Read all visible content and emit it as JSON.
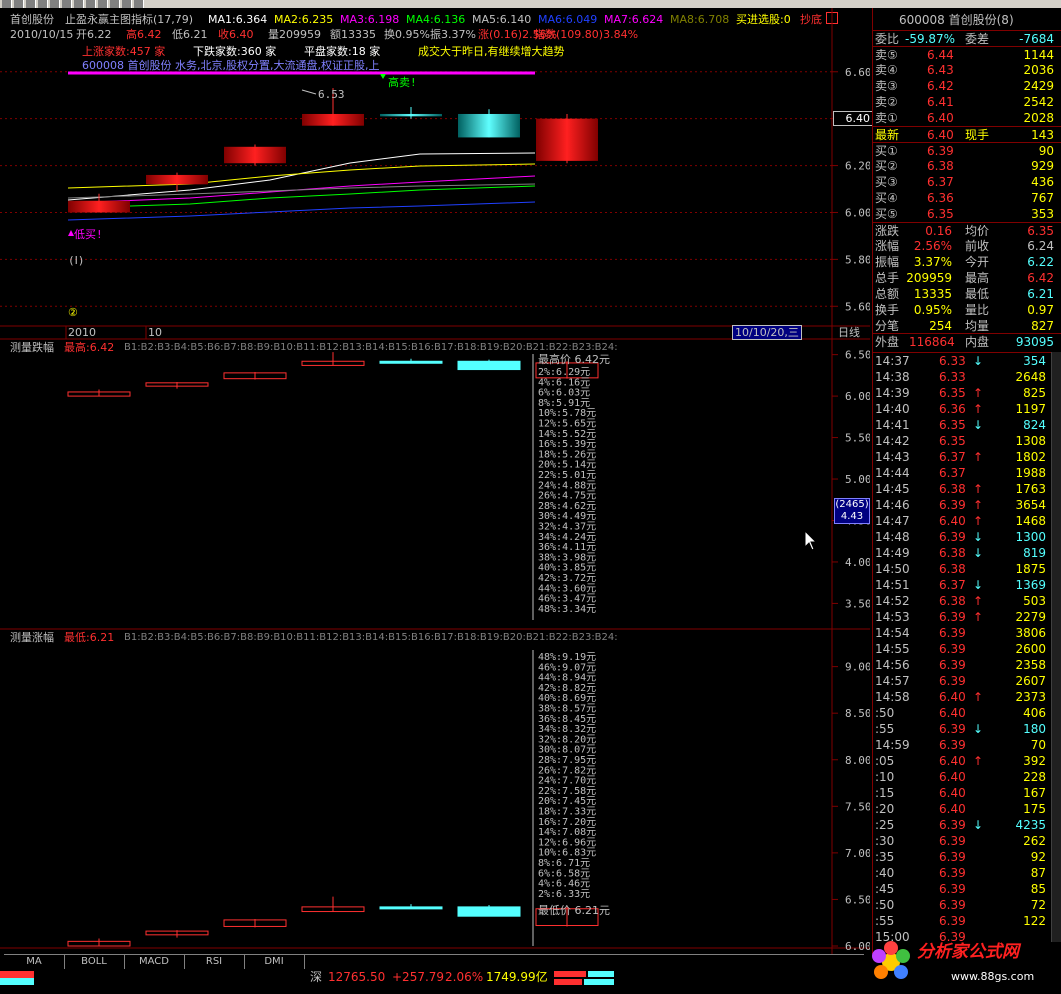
{
  "colors": {
    "up": "#ff3030",
    "down": "#54ffff",
    "flat": "#c0c0c0",
    "grid": "#800000",
    "yellow": "#ffff00",
    "magenta": "#ff00ff",
    "white": "#ffffff",
    "green": "#00ff00",
    "blue": "#2040ff",
    "purple": "#b000b0"
  },
  "header": {
    "stock_name": "首创股份",
    "indicator": "止盈永赢主图指标(17,79)",
    "ma1": "MA1:6.364",
    "ma2": "MA2:6.235",
    "ma3": "MA3:6.198",
    "ma4": "MA4:6.136",
    "ma5": "MA5:6.140",
    "ma6": "MA6:6.049",
    "ma7": "MA7:6.624",
    "ma8": "MA8:6.708",
    "buy_pick": "买进选股:0",
    "cta": "抄底",
    "date": "2010/10/15",
    "open": "开6.22",
    "high": "高6.42",
    "low": "低6.21",
    "close": "收6.40",
    "vol": "量209959",
    "amount": "额13335",
    "turn": "换0.95%",
    "amp": "振3.37%",
    "chg": "涨(0.16)2.56%",
    "index_chg": "指数(109.80)3.84%"
  },
  "main_overlay": {
    "up_count": "上涨家数:457 家",
    "down_count": "下跌家数:360 家",
    "flat_count": "平盘家数:18 家",
    "comment": "成交大于昨日,有继续增大趋势",
    "concepts": "600008 首创股份 水务,北京,股权分置,大流通盘,权证正股,上",
    "label_high": "6.53",
    "label_sell": "高卖!",
    "label_low": "低买!",
    "label_wave": "(Ⅰ)",
    "label_circle": "②"
  },
  "x_axis": {
    "year": "2010",
    "month": "10",
    "current_date": "10/10/20,三",
    "period": "日线"
  },
  "panel2": {
    "title": "测量跌幅",
    "best_label": "最高:6.42",
    "b_labels": "B1:B2:B3:B4:B5:B6:B7:B8:B9:B10:B11:B12:B13:B14:B15:B16:B17:B18:B19:B20:B21:B22:B23:B24:",
    "top_label": "最高价 6.42元",
    "levels": [
      "2%:6.29元",
      "4%:6.16元",
      "6%:6.03元",
      "8%:5.91元",
      "10%:5.78元",
      "12%:5.65元",
      "14%:5.52元",
      "16%:5.39元",
      "18%:5.26元",
      "20%:5.14元",
      "22%:5.01元",
      "24%:4.88元",
      "26%:4.75元",
      "28%:4.62元",
      "30%:4.49元",
      "32%:4.37元",
      "34%:4.24元",
      "36%:4.11元",
      "38%:3.98元",
      "40%:3.85元",
      "42%:3.72元",
      "44%:3.60元",
      "46%:3.47元",
      "48%:3.34元"
    ],
    "axis": [
      "6.50",
      "6.00",
      "5.50",
      "5.00",
      "4.50",
      "4.00",
      "3.50"
    ],
    "cursor_box": "(2465)",
    "cursor_val": "4.43"
  },
  "panel3": {
    "title": "测量涨幅",
    "best_label": "最低:6.21",
    "b_labels": "B1:B2:B3:B4:B5:B6:B7:B8:B9:B10:B11:B12:B13:B14:B15:B16:B17:B18:B19:B20:B21:B22:B23:B24:",
    "bottom_label": "最低价 6.21元",
    "levels": [
      "48%:9.19元",
      "46%:9.07元",
      "44%:8.94元",
      "42%:8.82元",
      "40%:8.69元",
      "38%:8.57元",
      "36%:8.45元",
      "34%:8.32元",
      "32%:8.20元",
      "30%:8.07元",
      "28%:7.95元",
      "26%:7.82元",
      "24%:7.70元",
      "22%:7.58元",
      "20%:7.45元",
      "18%:7.33元",
      "16%:7.20元",
      "14%:7.08元",
      "12%:6.96元",
      "10%:6.83元",
      "8%:6.71元",
      "6%:6.58元",
      "4%:6.46元",
      "2%:6.33元"
    ],
    "axis": [
      "9.00",
      "8.50",
      "8.00",
      "7.50",
      "7.00",
      "6.50",
      "6.00"
    ]
  },
  "main_axis": [
    "6.60",
    "6.40",
    "6.20",
    "6.00",
    "5.80",
    "5.60"
  ],
  "main_axis_cursor": "6.40",
  "quote": {
    "title": "600008 首创股份(8)",
    "weibi_label": "委比",
    "weibi": "-59.87%",
    "weicha_label": "委差",
    "weicha": "-7684",
    "sells": [
      {
        "label": "卖⑤",
        "price": "6.44",
        "vol": "1144"
      },
      {
        "label": "卖④",
        "price": "6.43",
        "vol": "2036"
      },
      {
        "label": "卖③",
        "price": "6.42",
        "vol": "2429"
      },
      {
        "label": "卖②",
        "price": "6.41",
        "vol": "2542"
      },
      {
        "label": "卖①",
        "price": "6.40",
        "vol": "2028"
      }
    ],
    "latest_label": "最新",
    "latest": "6.40",
    "now_label": "现手",
    "now": "143",
    "buys": [
      {
        "label": "买①",
        "price": "6.39",
        "vol": "90"
      },
      {
        "label": "买②",
        "price": "6.38",
        "vol": "929"
      },
      {
        "label": "买③",
        "price": "6.37",
        "vol": "436"
      },
      {
        "label": "买④",
        "price": "6.36",
        "vol": "767"
      },
      {
        "label": "买⑤",
        "price": "6.35",
        "vol": "353"
      }
    ],
    "stats": [
      {
        "l1": "涨跌",
        "v1": "0.16",
        "l2": "均价",
        "v2": "6.35"
      },
      {
        "l1": "涨幅",
        "v1": "2.56%",
        "l2": "前收",
        "v2": "6.24"
      },
      {
        "l1": "振幅",
        "v1": "3.37%",
        "l2": "今开",
        "v2": "6.22"
      },
      {
        "l1": "总手",
        "v1": "209959",
        "l2": "最高",
        "v2": "6.42"
      },
      {
        "l1": "总额",
        "v1": "13335",
        "l2": "最低",
        "v2": "6.21"
      },
      {
        "l1": "换手",
        "v1": "0.95%",
        "l2": "量比",
        "v2": "0.97"
      },
      {
        "l1": "分笔",
        "v1": "254",
        "l2": "均量",
        "v2": "827"
      }
    ],
    "outer_label": "外盘",
    "outer": "116864",
    "inner_label": "内盘",
    "inner": "93095"
  },
  "ticks": [
    {
      "t": "14:37",
      "p": "6.33",
      "a": "↓",
      "v": "354"
    },
    {
      "t": "14:38",
      "p": "6.33",
      "a": "",
      "v": "2648"
    },
    {
      "t": "14:39",
      "p": "6.35",
      "a": "↑",
      "v": "825"
    },
    {
      "t": "14:40",
      "p": "6.36",
      "a": "↑",
      "v": "1197"
    },
    {
      "t": "14:41",
      "p": "6.35",
      "a": "↓",
      "v": "824"
    },
    {
      "t": "14:42",
      "p": "6.35",
      "a": "",
      "v": "1308"
    },
    {
      "t": "14:43",
      "p": "6.37",
      "a": "↑",
      "v": "1802"
    },
    {
      "t": "14:44",
      "p": "6.37",
      "a": "",
      "v": "1988"
    },
    {
      "t": "14:45",
      "p": "6.38",
      "a": "↑",
      "v": "1763"
    },
    {
      "t": "14:46",
      "p": "6.39",
      "a": "↑",
      "v": "3654"
    },
    {
      "t": "14:47",
      "p": "6.40",
      "a": "↑",
      "v": "1468"
    },
    {
      "t": "14:48",
      "p": "6.39",
      "a": "↓",
      "v": "1300"
    },
    {
      "t": "14:49",
      "p": "6.38",
      "a": "↓",
      "v": "819"
    },
    {
      "t": "14:50",
      "p": "6.38",
      "a": "",
      "v": "1875"
    },
    {
      "t": "14:51",
      "p": "6.37",
      "a": "↓",
      "v": "1369"
    },
    {
      "t": "14:52",
      "p": "6.38",
      "a": "↑",
      "v": "503"
    },
    {
      "t": "14:53",
      "p": "6.39",
      "a": "↑",
      "v": "2279"
    },
    {
      "t": "14:54",
      "p": "6.39",
      "a": "",
      "v": "3806"
    },
    {
      "t": "14:55",
      "p": "6.39",
      "a": "",
      "v": "2600"
    },
    {
      "t": "14:56",
      "p": "6.39",
      "a": "",
      "v": "2358"
    },
    {
      "t": "14:57",
      "p": "6.39",
      "a": "",
      "v": "2607"
    },
    {
      "t": "14:58",
      "p": "6.40",
      "a": "↑",
      "v": "2373"
    },
    {
      "t": ":50",
      "p": "6.40",
      "a": "",
      "v": "406"
    },
    {
      "t": ":55",
      "p": "6.39",
      "a": "↓",
      "v": "180"
    },
    {
      "t": "14:59",
      "p": "6.39",
      "a": "",
      "v": "70"
    },
    {
      "t": ":05",
      "p": "6.40",
      "a": "↑",
      "v": "392"
    },
    {
      "t": ":10",
      "p": "6.40",
      "a": "",
      "v": "228"
    },
    {
      "t": ":15",
      "p": "6.40",
      "a": "",
      "v": "167"
    },
    {
      "t": ":20",
      "p": "6.40",
      "a": "",
      "v": "175"
    },
    {
      "t": ":25",
      "p": "6.39",
      "a": "↓",
      "v": "4235"
    },
    {
      "t": ":30",
      "p": "6.39",
      "a": "",
      "v": "262"
    },
    {
      "t": ":35",
      "p": "6.39",
      "a": "",
      "v": "92"
    },
    {
      "t": ":40",
      "p": "6.39",
      "a": "",
      "v": "87"
    },
    {
      "t": ":45",
      "p": "6.39",
      "a": "",
      "v": "85"
    },
    {
      "t": ":50",
      "p": "6.39",
      "a": "",
      "v": "72"
    },
    {
      "t": ":55",
      "p": "6.39",
      "a": "",
      "v": "122"
    },
    {
      "t": "15:00",
      "p": "6.39",
      "a": "",
      "v": ""
    }
  ],
  "tabs": [
    "MA",
    "BOLL",
    "MACD",
    "RSI",
    "DMI"
  ],
  "status": {
    "market": "深",
    "index": "12765.50",
    "change": "+257.79",
    "pct": "2.06%",
    "amount": "1749.99亿"
  },
  "logo": {
    "text": "分析家公式网",
    "url": "www.88gs.com"
  },
  "chart_data": {
    "type": "candlestick",
    "candles": [
      {
        "open": 6.05,
        "high": 6.08,
        "low": 6.0,
        "close": 6.0
      },
      {
        "open": 6.16,
        "high": 6.17,
        "low": 6.09,
        "close": 6.12
      },
      {
        "open": 6.28,
        "high": 6.29,
        "low": 6.2,
        "close": 6.21
      },
      {
        "open": 6.42,
        "high": 6.53,
        "low": 6.37,
        "close": 6.37
      },
      {
        "open": 6.42,
        "high": 6.45,
        "low": 6.4,
        "close": 6.41
      },
      {
        "open": 6.42,
        "high": 6.44,
        "low": 6.32,
        "close": 6.32
      },
      {
        "open": 6.4,
        "high": 6.42,
        "low": 6.21,
        "close": 6.22
      }
    ],
    "candle_colors": [
      "up",
      "up",
      "up",
      "up",
      "down",
      "down",
      "up"
    ],
    "main_ylim": [
      5.55,
      6.68
    ],
    "panel2_ylim": [
      3.3,
      6.58
    ],
    "panel3_ylim": [
      6.0,
      9.2
    ]
  }
}
